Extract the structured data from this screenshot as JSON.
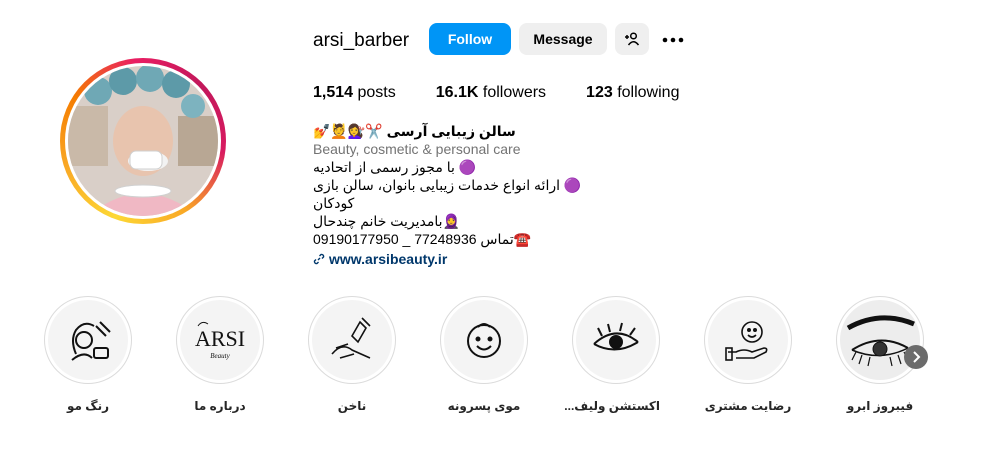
{
  "profile": {
    "username": "arsi_barber",
    "follow_label": "Follow",
    "message_label": "Message",
    "stats": {
      "posts_count": "1,514",
      "posts_label": "posts",
      "followers_count": "16.1K",
      "followers_label": "followers",
      "following_count": "123",
      "following_label": "following"
    },
    "bio": {
      "name": "سالن زیبایی آرسی ✂️💇‍♀️💆💅",
      "category": "Beauty, cosmetic & personal care",
      "line1": "🟣 با مجوز رسمی از اتحادیه",
      "line2": "🟣 ارائه انواع خدمات زیبایی بانوان، سالن بازی کودکان",
      "line3": "🧕بامدیریت خانم چندحال",
      "line4": "☎️تماس 77248936 _ 09190177950",
      "link": "www.arsibeauty.ir"
    }
  },
  "highlights": [
    {
      "label": "رنگ مو",
      "icon": "hair-color-icon"
    },
    {
      "label": "درباره ما",
      "icon": "arsi-logo-icon"
    },
    {
      "label": "ناخن",
      "icon": "nail-polish-icon"
    },
    {
      "label": "موی پسرونه",
      "icon": "boy-face-icon"
    },
    {
      "label": "اکستشن ولیف...",
      "icon": "eyelash-icon"
    },
    {
      "label": "رضایت مشتری",
      "icon": "satisfaction-icon"
    },
    {
      "label": "فیبروز ابرو",
      "icon": "eyebrow-icon"
    }
  ],
  "colors": {
    "follow_blue": "#0095f6",
    "button_gray": "#efefef",
    "link_blue": "#00376b"
  }
}
